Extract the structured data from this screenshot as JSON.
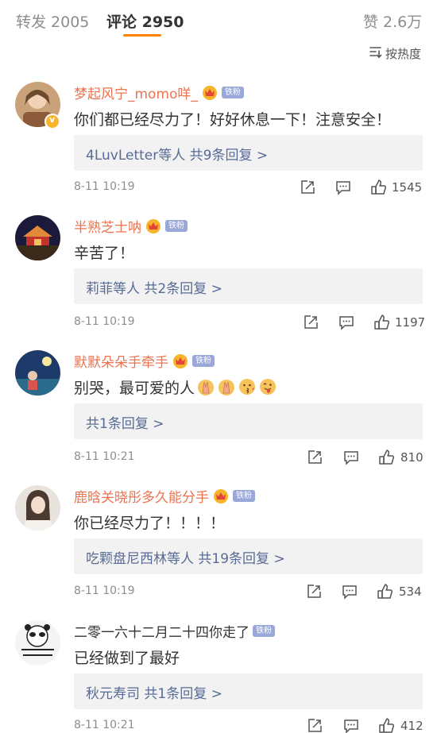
{
  "tabs": {
    "repost": "转发 2005",
    "comments": "评论 2950",
    "likes": "赞 2.6万"
  },
  "sort": {
    "label": "按热度",
    "icon": "sort-icon"
  },
  "accent_color": "#ff8200",
  "username_color": "#eb7350",
  "link_color": "#586b95",
  "fan_badge": "铁粉",
  "comments": [
    {
      "username": "梦起风宁_momo咩_",
      "text": "你们都已经尽力了！好好休息一下！注意安全！",
      "replies": "4LuvLetter等人  共9条回复 >",
      "time": "8-11 10:19",
      "likes": "1545"
    },
    {
      "username": "半熟芝士呐",
      "text": "辛苦了！",
      "replies": "莉菲等人  共2条回复 >",
      "time": "8-11 10:19",
      "likes": "1197"
    },
    {
      "username": "默默朵朵手牵手",
      "text": "别哭，最可爱的人",
      "replies": "共1条回复 >",
      "time": "8-11 10:21",
      "likes": "810"
    },
    {
      "username": "鹿晗关晓彤多久能分手",
      "text": "你已经尽力了！！！！",
      "replies": "吃颗盘尼西林等人  共19条回复 >",
      "time": "8-11 10:19",
      "likes": "534"
    },
    {
      "username": "二零一六十二月二十四你走了",
      "text": "已经做到了最好",
      "replies": "秋元寿司  共1条回复 >",
      "time": "8-11 10:21",
      "likes": "412"
    }
  ]
}
